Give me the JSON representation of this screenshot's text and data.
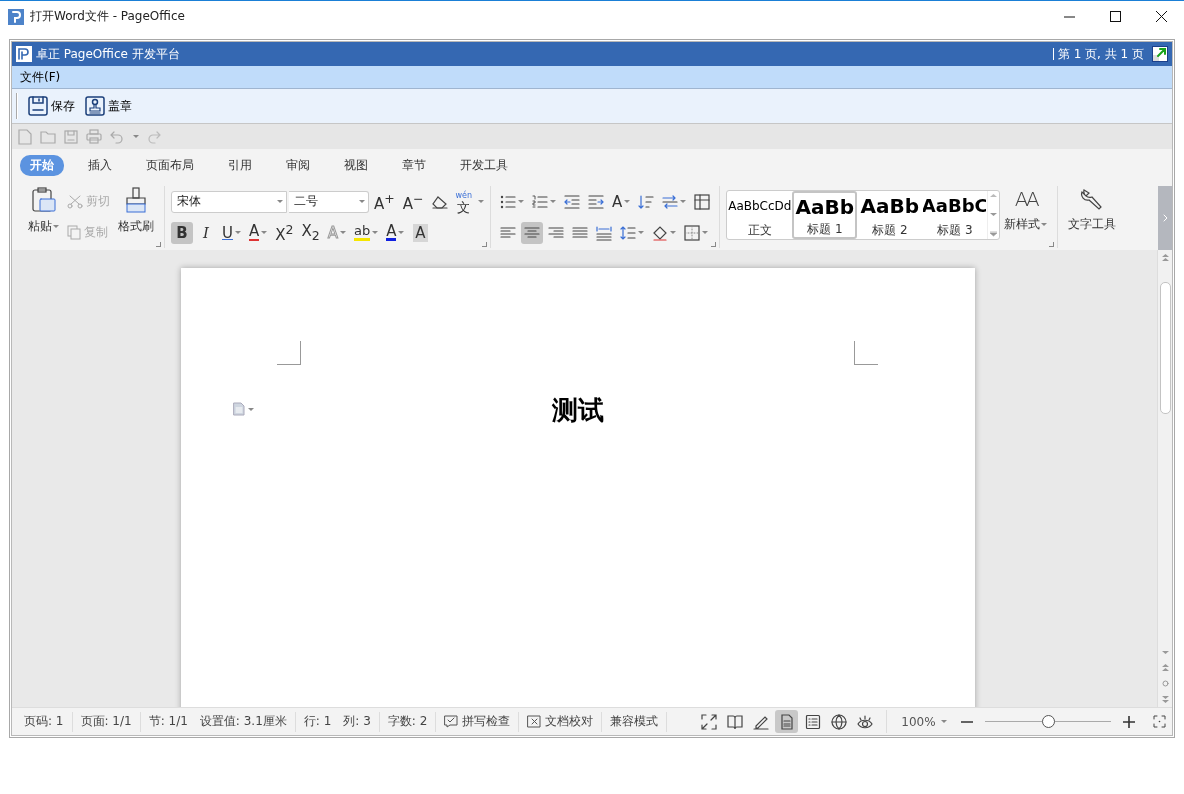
{
  "window": {
    "title": "打开Word文件 - PageOffice"
  },
  "app_header": {
    "title": "卓正 PageOffice 开发平台",
    "page_info": "第 1 页, 共 1 页"
  },
  "menu": [
    {
      "label": "文件(F)"
    }
  ],
  "toolbar": [
    {
      "kind": "save",
      "label": "保存"
    },
    {
      "kind": "stamp",
      "label": "盖章"
    }
  ],
  "ribbon_tabs": [
    {
      "label": "开始",
      "selected": true
    },
    {
      "label": "插入",
      "selected": false
    },
    {
      "label": "页面布局",
      "selected": false
    },
    {
      "label": "引用",
      "selected": false
    },
    {
      "label": "审阅",
      "selected": false
    },
    {
      "label": "视图",
      "selected": false
    },
    {
      "label": "章节",
      "selected": false
    },
    {
      "label": "开发工具",
      "selected": false
    }
  ],
  "clipboard": {
    "paste": "粘贴",
    "cut": {
      "label": "剪切",
      "disabled": true
    },
    "copy": {
      "label": "复制",
      "disabled": true
    },
    "format_painter": "格式刷"
  },
  "font": {
    "name": "宋体",
    "size": "二号",
    "row1": [
      {
        "kind": "grow",
        "glyph": "A$^{+}$"
      },
      {
        "kind": "shrink",
        "glyph": "A$^{−}$"
      },
      {
        "kind": "eraser"
      },
      {
        "kind": "phonetic",
        "glyph": "文",
        "ruby": "wén"
      }
    ],
    "row2": [
      {
        "kind": "bold",
        "glyph": "B",
        "selected": true
      },
      {
        "kind": "italic",
        "glyph": "I",
        "selected": false
      },
      {
        "kind": "underline",
        "glyph": "U",
        "selected": false
      },
      {
        "kind": "strike",
        "glyph": "A",
        "selected": false
      },
      {
        "kind": "super",
        "glyph": "X$^{2}$",
        "selected": false
      },
      {
        "kind": "sub",
        "glyph": "X$_{2}$",
        "selected": false
      },
      {
        "kind": "effect",
        "glyph": "A",
        "selected": false
      },
      {
        "kind": "highlight",
        "glyph": "ab",
        "selected": false
      },
      {
        "kind": "color",
        "glyph": "A",
        "selected": false
      },
      {
        "kind": "shade",
        "glyph": "A",
        "selected": false
      }
    ]
  },
  "paragraph": {
    "direction_glyph": "A",
    "alignment": [
      {
        "kind": "left",
        "selected": false
      },
      {
        "kind": "center",
        "selected": true
      },
      {
        "kind": "right",
        "selected": false
      },
      {
        "kind": "justify",
        "selected": false
      },
      {
        "kind": "distribute",
        "selected": false
      }
    ]
  },
  "styles": {
    "items": [
      {
        "kind": "body",
        "preview": "AaBbCcDd",
        "label": "正文",
        "selected": false
      },
      {
        "kind": "h1",
        "preview": "AaBb",
        "label": "标题 1",
        "selected": true
      },
      {
        "kind": "h2",
        "preview": "AaBb",
        "label": "标题 2",
        "selected": false
      },
      {
        "kind": "h3",
        "preview": "AaBbC",
        "label": "标题 3",
        "selected": false
      }
    ],
    "new_style_glyph": "AA",
    "new_style": "新样式",
    "text_tools": "文字工具"
  },
  "document": {
    "heading": "测试"
  },
  "status_bar": {
    "groups": [
      {
        "items": [
          {
            "kind": "text",
            "label": "页码: 1"
          }
        ]
      },
      {
        "items": [
          {
            "kind": "text",
            "label": "页面: 1/1"
          }
        ]
      },
      {
        "items": [
          {
            "kind": "text",
            "label": "节: 1/1"
          },
          {
            "kind": "text",
            "label": "设置值: 3.1厘米"
          }
        ]
      },
      {
        "items": [
          {
            "kind": "text",
            "label": "行: 1"
          },
          {
            "kind": "text",
            "label": "列: 3"
          }
        ]
      },
      {
        "items": [
          {
            "kind": "text",
            "label": "字数: 2"
          }
        ]
      },
      {
        "items": [
          {
            "kind": "spell",
            "label": "拼写检查"
          }
        ]
      },
      {
        "items": [
          {
            "kind": "proof",
            "label": "文档校对"
          }
        ]
      },
      {
        "items": [
          {
            "kind": "text",
            "label": "兼容模式"
          }
        ]
      }
    ],
    "views": [
      {
        "kind": "fullscreen",
        "selected": false
      },
      {
        "kind": "reading",
        "selected": false
      },
      {
        "kind": "edit",
        "selected": false
      },
      {
        "kind": "page",
        "selected": true
      },
      {
        "kind": "outline",
        "selected": false
      },
      {
        "kind": "web",
        "selected": false
      },
      {
        "kind": "eye",
        "selected": false
      }
    ],
    "zoom": "100%",
    "zoom_slider": {
      "level": 0.5
    }
  }
}
